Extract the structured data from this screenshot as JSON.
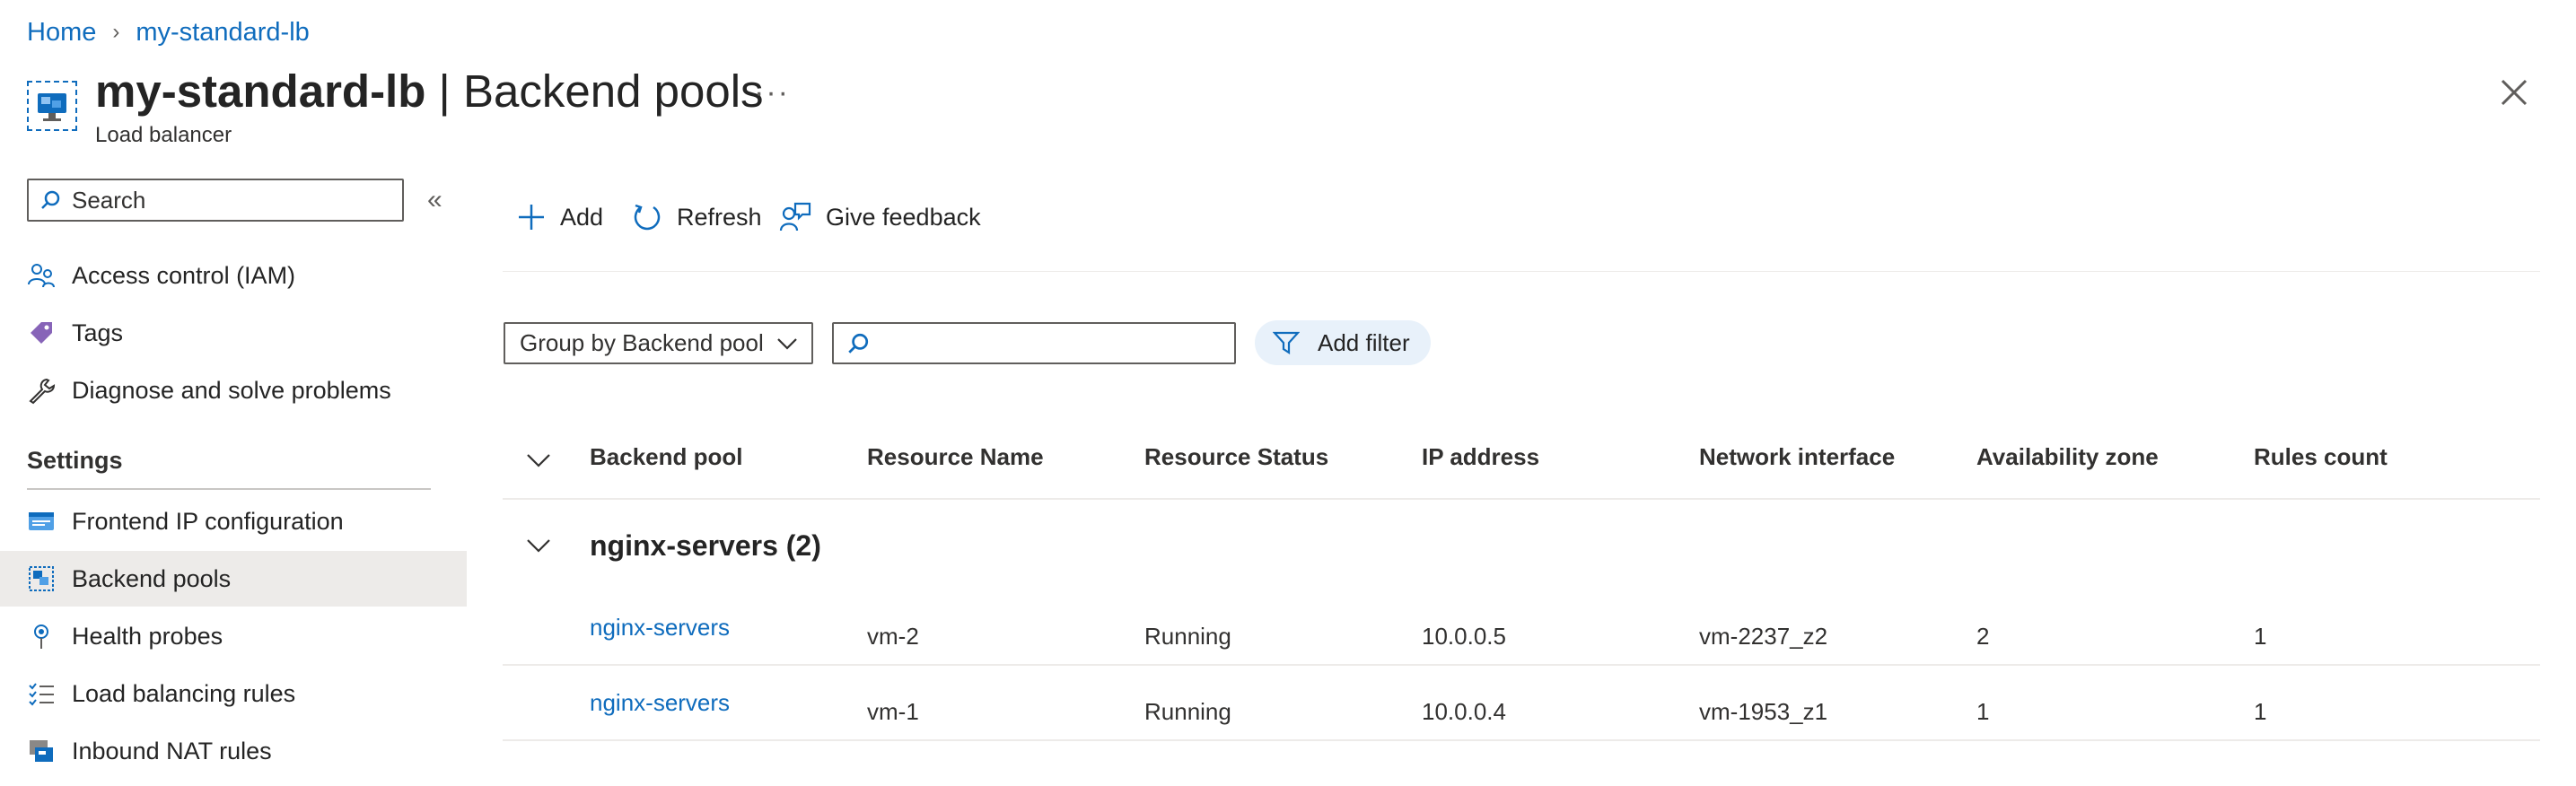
{
  "breadcrumb": {
    "home": "Home",
    "current": "my-standard-lb"
  },
  "header": {
    "resource_name": "my-standard-lb",
    "separator": " | ",
    "page": "Backend pools",
    "subtitle": "Load balancer",
    "more": "···"
  },
  "sidebar": {
    "search_placeholder": "Search",
    "items_top": [
      {
        "label": "Access control (IAM)",
        "icon": "people-icon"
      },
      {
        "label": "Tags",
        "icon": "tag-icon"
      },
      {
        "label": "Diagnose and solve problems",
        "icon": "wrench-icon"
      }
    ],
    "section": "Settings",
    "items_settings": [
      {
        "label": "Frontend IP configuration",
        "icon": "frontend-ip-icon"
      },
      {
        "label": "Backend pools",
        "icon": "backend-pool-icon",
        "selected": true
      },
      {
        "label": "Health probes",
        "icon": "probe-icon"
      },
      {
        "label": "Load balancing rules",
        "icon": "rules-icon"
      },
      {
        "label": "Inbound NAT rules",
        "icon": "nat-icon"
      }
    ]
  },
  "toolbar": {
    "add": "Add",
    "refresh": "Refresh",
    "feedback": "Give feedback"
  },
  "filters": {
    "group_by": "Group by Backend pool",
    "search_value": "",
    "add_filter": "Add filter"
  },
  "table": {
    "columns": [
      "Backend pool",
      "Resource Name",
      "Resource Status",
      "IP address",
      "Network interface",
      "Availability zone",
      "Rules count"
    ],
    "group": "nginx-servers (2)",
    "rows": [
      [
        "nginx-servers",
        "vm-2",
        "Running",
        "10.0.0.5",
        "vm-2237_z2",
        "2",
        "1"
      ],
      [
        "nginx-servers",
        "vm-1",
        "Running",
        "10.0.0.4",
        "vm-1953_z1",
        "1",
        "1"
      ]
    ]
  },
  "colors": {
    "accent": "#0f6cbd",
    "selected_bg": "#edebe9",
    "filter_pill_bg": "#e8f1fa"
  }
}
